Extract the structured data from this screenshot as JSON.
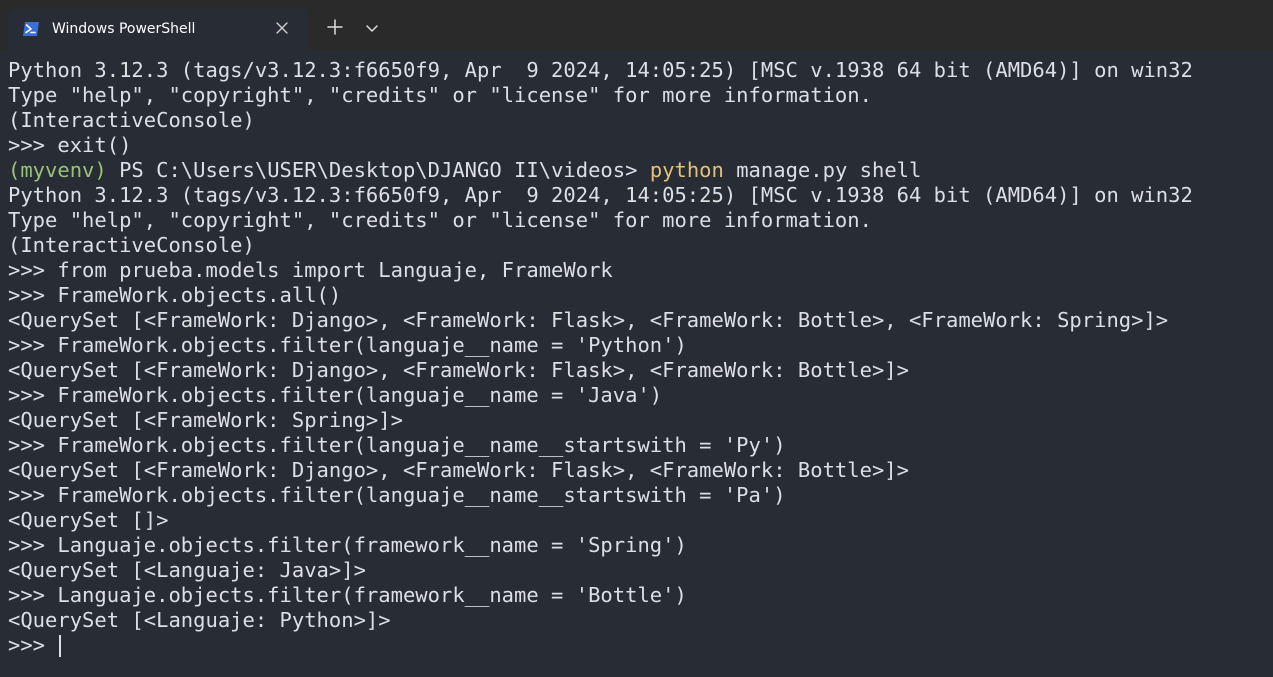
{
  "tab": {
    "title": "Windows PowerShell",
    "icon": "powershell-icon"
  },
  "colors": {
    "background": "#282c34",
    "titlebar": "#2a2a2a",
    "text": "#dcdfe4",
    "env": "#98c379",
    "command": "#e5c07b"
  },
  "terminal": {
    "lines": [
      "Python 3.12.3 (tags/v3.12.3:f6650f9, Apr  9 2024, 14:05:25) [MSC v.1938 64 bit (AMD64)] on win32",
      "Type \"help\", \"copyright\", \"credits\" or \"license\" for more information.",
      "(InteractiveConsole)",
      ">>> exit()",
      "",
      "Python 3.12.3 (tags/v3.12.3:f6650f9, Apr  9 2024, 14:05:25) [MSC v.1938 64 bit (AMD64)] on win32",
      "Type \"help\", \"copyright\", \"credits\" or \"license\" for more information.",
      "(InteractiveConsole)",
      ">>> from prueba.models import Languaje, FrameWork",
      ">>> FrameWork.objects.all()",
      "<QuerySet [<FrameWork: Django>, <FrameWork: Flask>, <FrameWork: Bottle>, <FrameWork: Spring>]>",
      ">>> FrameWork.objects.filter(languaje__name = 'Python')",
      "<QuerySet [<FrameWork: Django>, <FrameWork: Flask>, <FrameWork: Bottle>]>",
      ">>> FrameWork.objects.filter(languaje__name = 'Java')",
      "<QuerySet [<FrameWork: Spring>]>",
      ">>> FrameWork.objects.filter(languaje__name__startswith = 'Py')",
      "<QuerySet [<FrameWork: Django>, <FrameWork: Flask>, <FrameWork: Bottle>]>",
      ">>> FrameWork.objects.filter(languaje__name__startswith = 'Pa')",
      "<QuerySet []>",
      ">>> Languaje.objects.filter(framework__name = 'Spring')",
      "<QuerySet [<Languaje: Java>]>",
      ">>> Languaje.objects.filter(framework__name = 'Bottle')",
      "<QuerySet [<Languaje: Python>]>"
    ],
    "ps_line": {
      "env": "(myvenv)",
      "prompt": " PS C:\\Users\\USER\\Desktop\\DJANGO II\\videos> ",
      "command": "python",
      "args": " manage.py shell"
    },
    "current_prompt": ">>> "
  }
}
